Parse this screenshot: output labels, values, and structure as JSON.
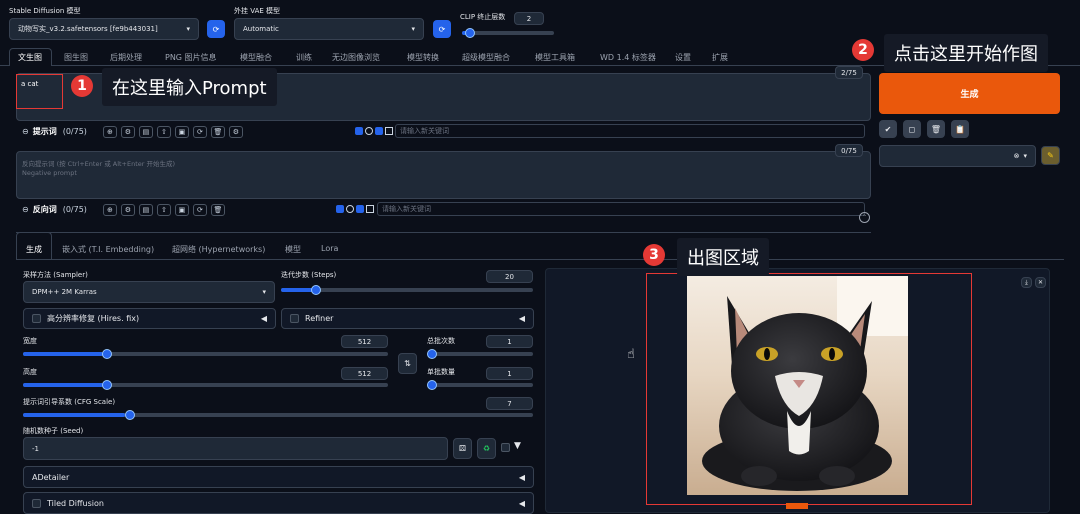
{
  "header": {
    "sd_model_label": "Stable Diffusion 模型",
    "sd_model_value": "动物写实_v3.2.safetensors [fe9b443031]",
    "vae_label": "外挂 VAE 模型",
    "vae_value": "Automatic",
    "clip_label": "CLIP 终止层数",
    "clip_value": "2",
    "clip_fraction": 0.08
  },
  "tabs": [
    "文生图",
    "图生图",
    "后期处理",
    "PNG 图片信息",
    "模型融合",
    "训练",
    "无边图像浏览",
    "模型转换",
    "超级模型融合",
    "模型工具箱",
    "WD 1.4 标签器",
    "设置",
    "扩展"
  ],
  "prompt": {
    "value": "a cat",
    "counter": "2/75",
    "label": "提示词",
    "count": "(0/75)",
    "keyword_placeholder": "请输入新关键词"
  },
  "negative": {
    "placeholder1": "反向提示词 (按 Ctrl+Enter 或 Alt+Enter 开始生成)",
    "placeholder2": "Negative prompt",
    "counter": "0/75",
    "label": "反向词",
    "count": "(0/75)",
    "keyword_placeholder": "请输入新关键词"
  },
  "generate_label": "生成",
  "subtabs": [
    "生成",
    "嵌入式 (T.I. Embedding)",
    "超网络 (Hypernetworks)",
    "模型",
    "Lora"
  ],
  "params": {
    "sampler_label": "采样方法 (Sampler)",
    "sampler_value": "DPM++ 2M Karras",
    "steps_label": "迭代步数 (Steps)",
    "steps_value": "20",
    "steps_fraction": 0.14,
    "hires_label": "高分辨率修复 (Hires. fix)",
    "refiner_label": "Refiner",
    "width_label": "宽度",
    "width_value": "512",
    "width_fraction": 0.22,
    "height_label": "高度",
    "height_value": "512",
    "height_fraction": 0.22,
    "batch_count_label": "总批次数",
    "batch_count_value": "1",
    "batch_size_label": "单批数量",
    "batch_size_value": "1",
    "cfg_label": "提示词引导系数 (CFG Scale)",
    "cfg_value": "7",
    "cfg_fraction": 0.2,
    "seed_label": "随机数种子 (Seed)",
    "seed_value": "-1",
    "adetailer_label": "ADetailer",
    "tiled_label": "Tiled Diffusion"
  },
  "annotations": {
    "n1": "1",
    "t1": "在这里输入Prompt",
    "n2": "2",
    "t2": "点击这里开始作图",
    "n3": "3",
    "t3": "出图区域"
  },
  "colors": {
    "generate": "#ea580c",
    "accent": "#2563eb",
    "annotation_red": "#e53935"
  }
}
